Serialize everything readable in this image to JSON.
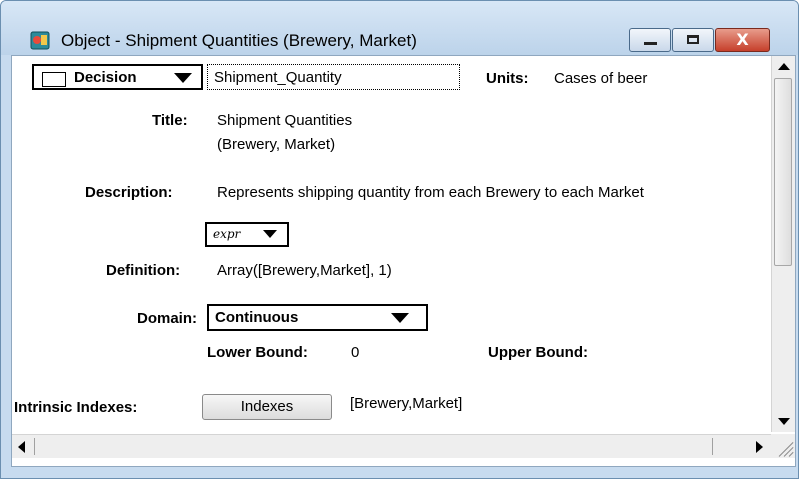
{
  "window": {
    "title": "Object - Shipment Quantities (Brewery, Market)",
    "icons": {
      "app": "analytica-object-icon",
      "minimize": "minimize-icon",
      "maximize": "maximize-icon",
      "close": "close-icon"
    },
    "close_glyph": "X"
  },
  "object": {
    "class_label": "Decision",
    "identifier": "Shipment_Quantity",
    "units_label": "Units:",
    "units_value": "Cases of beer",
    "title_label": "Title:",
    "title_line1": "Shipment Quantities",
    "title_line2": "(Brewery, Market)",
    "description_label": "Description:",
    "description_value": "Represents shipping quantity from each Brewery to each Market",
    "expr_label": "expr",
    "definition_label": "Definition:",
    "definition_value": "Array([Brewery,Market], 1)",
    "domain_label": "Domain:",
    "domain_value": "Continuous",
    "lower_bound_label": "Lower Bound:",
    "lower_bound_value": "0",
    "upper_bound_label": "Upper Bound:",
    "upper_bound_value": "",
    "intrinsic_label": "Intrinsic Indexes:",
    "indexes_button": "Indexes",
    "indexes_value": "[Brewery,Market]"
  },
  "colors": {
    "titlebar": "#c7dbef",
    "close_button": "#c6402b"
  }
}
